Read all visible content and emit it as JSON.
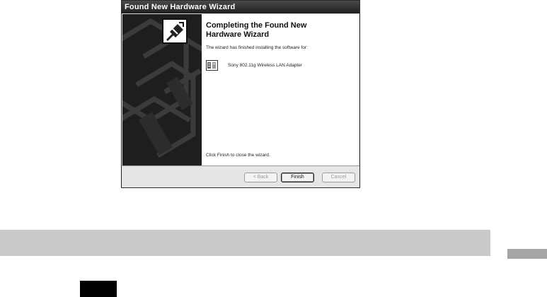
{
  "window": {
    "title": "Found New Hardware Wizard"
  },
  "content": {
    "heading_line1": "Completing the Found New",
    "heading_line2": "Hardware Wizard",
    "finished_text": "The wizard has finished installing the software for:",
    "device_name": "Sony 802.11g Wireless LAN Adapter",
    "close_text": "Click Finish to close the wizard."
  },
  "buttons": {
    "back": "< Back",
    "finish": "Finish",
    "cancel": "Cancel"
  },
  "icons": {
    "wizard_icon": "hardware-install-icon",
    "device_icon": "network-adapter-icon"
  },
  "colors": {
    "titlebar": "#2f2f2f",
    "side_panel": "#1e1e1e",
    "page_bar": "#c9c9c9",
    "side_tab": "#a5a5a5"
  }
}
